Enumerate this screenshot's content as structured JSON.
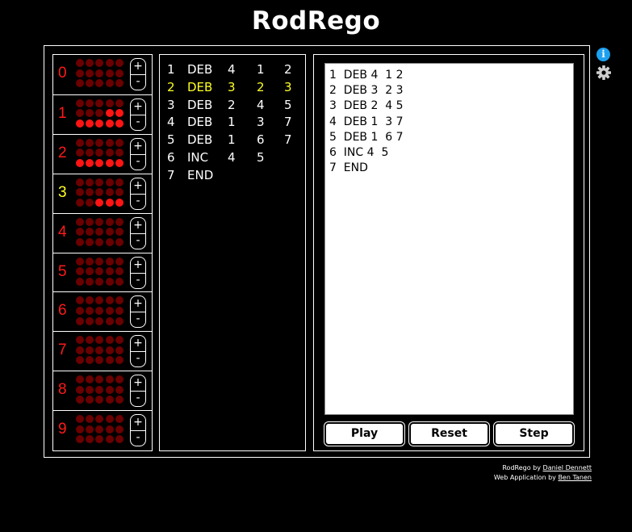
{
  "app": {
    "title": "RodRego"
  },
  "colors": {
    "register_active": "#ffff22",
    "register_number": "#ff1a1a",
    "bead_on": "#ff1414",
    "bead_off": "#6a0000",
    "info_icon": "#1ea0f0"
  },
  "registers": [
    {
      "number": "0",
      "value": 0,
      "inc": "+",
      "dec": "-",
      "active": false
    },
    {
      "number": "1",
      "value": 7,
      "inc": "+",
      "dec": "-",
      "active": false
    },
    {
      "number": "2",
      "value": 5,
      "inc": "+",
      "dec": "-",
      "active": false
    },
    {
      "number": "3",
      "value": 3,
      "inc": "+",
      "dec": "-",
      "active": true
    },
    {
      "number": "4",
      "value": 0,
      "inc": "+",
      "dec": "-",
      "active": false
    },
    {
      "number": "5",
      "value": 0,
      "inc": "+",
      "dec": "-",
      "active": false
    },
    {
      "number": "6",
      "value": 0,
      "inc": "+",
      "dec": "-",
      "active": false
    },
    {
      "number": "7",
      "value": 0,
      "inc": "+",
      "dec": "-",
      "active": false
    },
    {
      "number": "8",
      "value": 0,
      "inc": "+",
      "dec": "-",
      "active": false
    },
    {
      "number": "9",
      "value": 0,
      "inc": "+",
      "dec": "-",
      "active": false
    }
  ],
  "program": {
    "current_line": 2,
    "lines": [
      {
        "num": "1",
        "op": "DEB",
        "a": "4",
        "b": "1",
        "c": "2"
      },
      {
        "num": "2",
        "op": "DEB",
        "a": "3",
        "b": "2",
        "c": "3"
      },
      {
        "num": "3",
        "op": "DEB",
        "a": "2",
        "b": "4",
        "c": "5"
      },
      {
        "num": "4",
        "op": "DEB",
        "a": "1",
        "b": "3",
        "c": "7"
      },
      {
        "num": "5",
        "op": "DEB",
        "a": "1",
        "b": "6",
        "c": "7"
      },
      {
        "num": "6",
        "op": "INC",
        "a": "4",
        "b": "5",
        "c": ""
      },
      {
        "num": "7",
        "op": "END",
        "a": "",
        "b": "",
        "c": ""
      }
    ]
  },
  "editor": {
    "text": "1  DEB 4  1 2\n2  DEB 3  2 3\n3  DEB 2  4 5\n4  DEB 1  3 7\n5  DEB 1  6 7\n6  INC 4  5\n7  END"
  },
  "controls": {
    "play": "Play",
    "reset": "Reset",
    "step": "Step"
  },
  "icons": {
    "info": "info-icon",
    "settings": "gear-icon",
    "info_glyph": "i"
  },
  "credits": {
    "line1_prefix": "RodRego by ",
    "line1_link": "Daniel Dennett",
    "line2_prefix": "Web Application by ",
    "line2_link": "Ben Tanen"
  }
}
